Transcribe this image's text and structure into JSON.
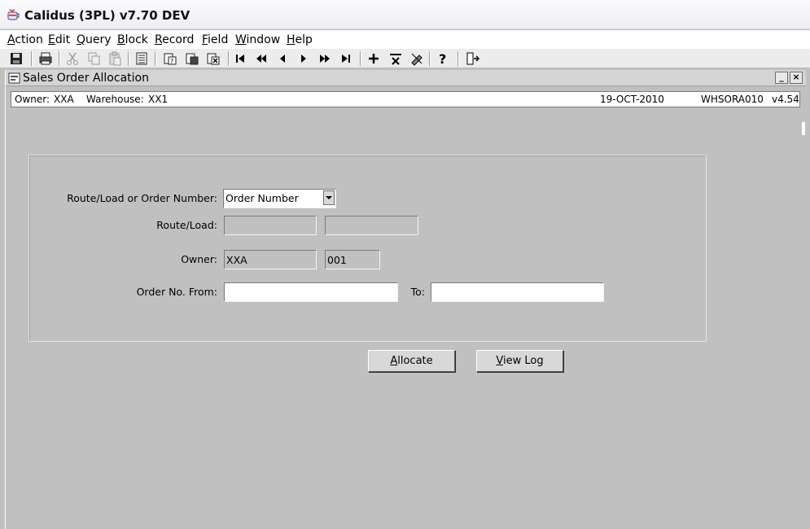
{
  "app": {
    "title": "Calidus (3PL) v7.70 DEV"
  },
  "menu": [
    {
      "ul": "A",
      "rest": "ction"
    },
    {
      "ul": "E",
      "rest": "dit"
    },
    {
      "ul": "Q",
      "rest": "uery"
    },
    {
      "ul": "B",
      "rest": "lock"
    },
    {
      "ul": "R",
      "rest": "ecord"
    },
    {
      "ul": "F",
      "rest": "ield"
    },
    {
      "ul": "W",
      "rest": "indow"
    },
    {
      "ul": "H",
      "rest": "elp"
    }
  ],
  "form": {
    "title": "Sales Order Allocation",
    "minimize": "_",
    "close": "×"
  },
  "info": {
    "owner_label": "Owner:",
    "owner_value": "XXA",
    "warehouse_label": "Warehouse:",
    "warehouse_value": "XX1",
    "date": "19-OCT-2010",
    "form_code": "WHSORA010",
    "version": "v4.54"
  },
  "fields": {
    "mode_label": "Route/Load or Order Number:",
    "mode_value": "Order Number",
    "route_label": "Route/Load:",
    "route_value1": "",
    "route_value2": "",
    "owner_label": "Owner:",
    "owner_value": "XXA",
    "owner_code": "001",
    "order_from_label": "Order No. From:",
    "order_from_value": "",
    "order_to_label": "To:",
    "order_to_value": ""
  },
  "buttons": {
    "allocate_ul": "A",
    "allocate_rest": "llocate",
    "viewlog_ul": "V",
    "viewlog_rest": "iew Log"
  }
}
